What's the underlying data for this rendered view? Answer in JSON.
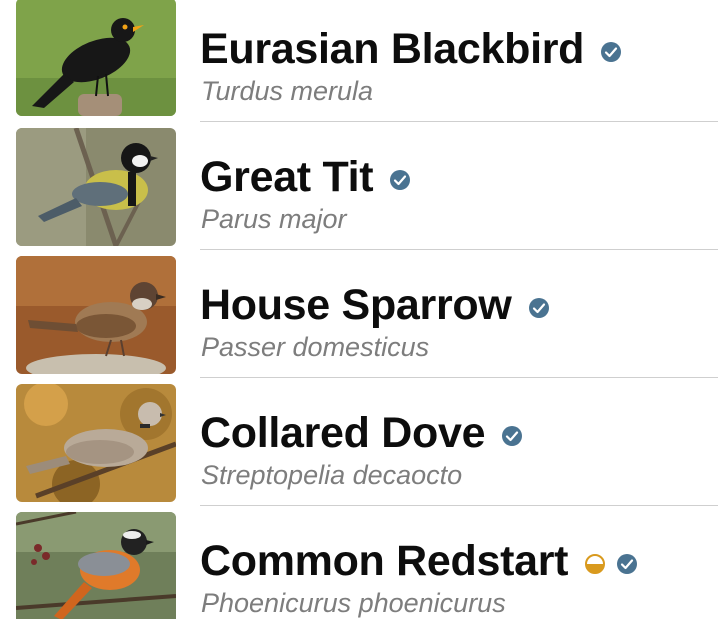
{
  "birds": [
    {
      "common_name": "Eurasian Blackbird",
      "scientific_name": "Turdus merula",
      "verified": true,
      "partial": false,
      "photo_icon": "blackbird-photo",
      "photo_colors": {
        "bg": "#7fa34a",
        "bird": "#171717",
        "beak": "#f2a216"
      }
    },
    {
      "common_name": "Great Tit",
      "scientific_name": "Parus major",
      "verified": true,
      "partial": false,
      "photo_icon": "great-tit-photo",
      "photo_colors": {
        "bg": "#8a8a6e",
        "bird": "#c9bf4a",
        "head": "#161616"
      }
    },
    {
      "common_name": "House Sparrow",
      "scientific_name": "Passer domesticus",
      "verified": true,
      "partial": false,
      "photo_icon": "house-sparrow-photo",
      "photo_colors": {
        "bg": "#9a5a2c",
        "bird": "#a07a54",
        "head": "#5e4433"
      }
    },
    {
      "common_name": "Collared Dove",
      "scientific_name": "Streptopelia decaocto",
      "verified": true,
      "partial": false,
      "photo_icon": "collared-dove-photo",
      "photo_colors": {
        "bg": "#b88a3c",
        "bird": "#b9aa98",
        "head": "#c8bcae"
      }
    },
    {
      "common_name": "Common Redstart",
      "scientific_name": "Phoenicurus phoenicurus",
      "verified": true,
      "partial": true,
      "photo_icon": "common-redstart-photo",
      "photo_colors": {
        "bg": "#6f7f5a",
        "bird": "#e07a2a",
        "head": "#222222"
      }
    }
  ],
  "colors": {
    "verified_badge": "#4a7391",
    "partial_badge": "#d99a1e",
    "divider": "#cfcfcf",
    "scientific_text": "#7d7d7d"
  }
}
